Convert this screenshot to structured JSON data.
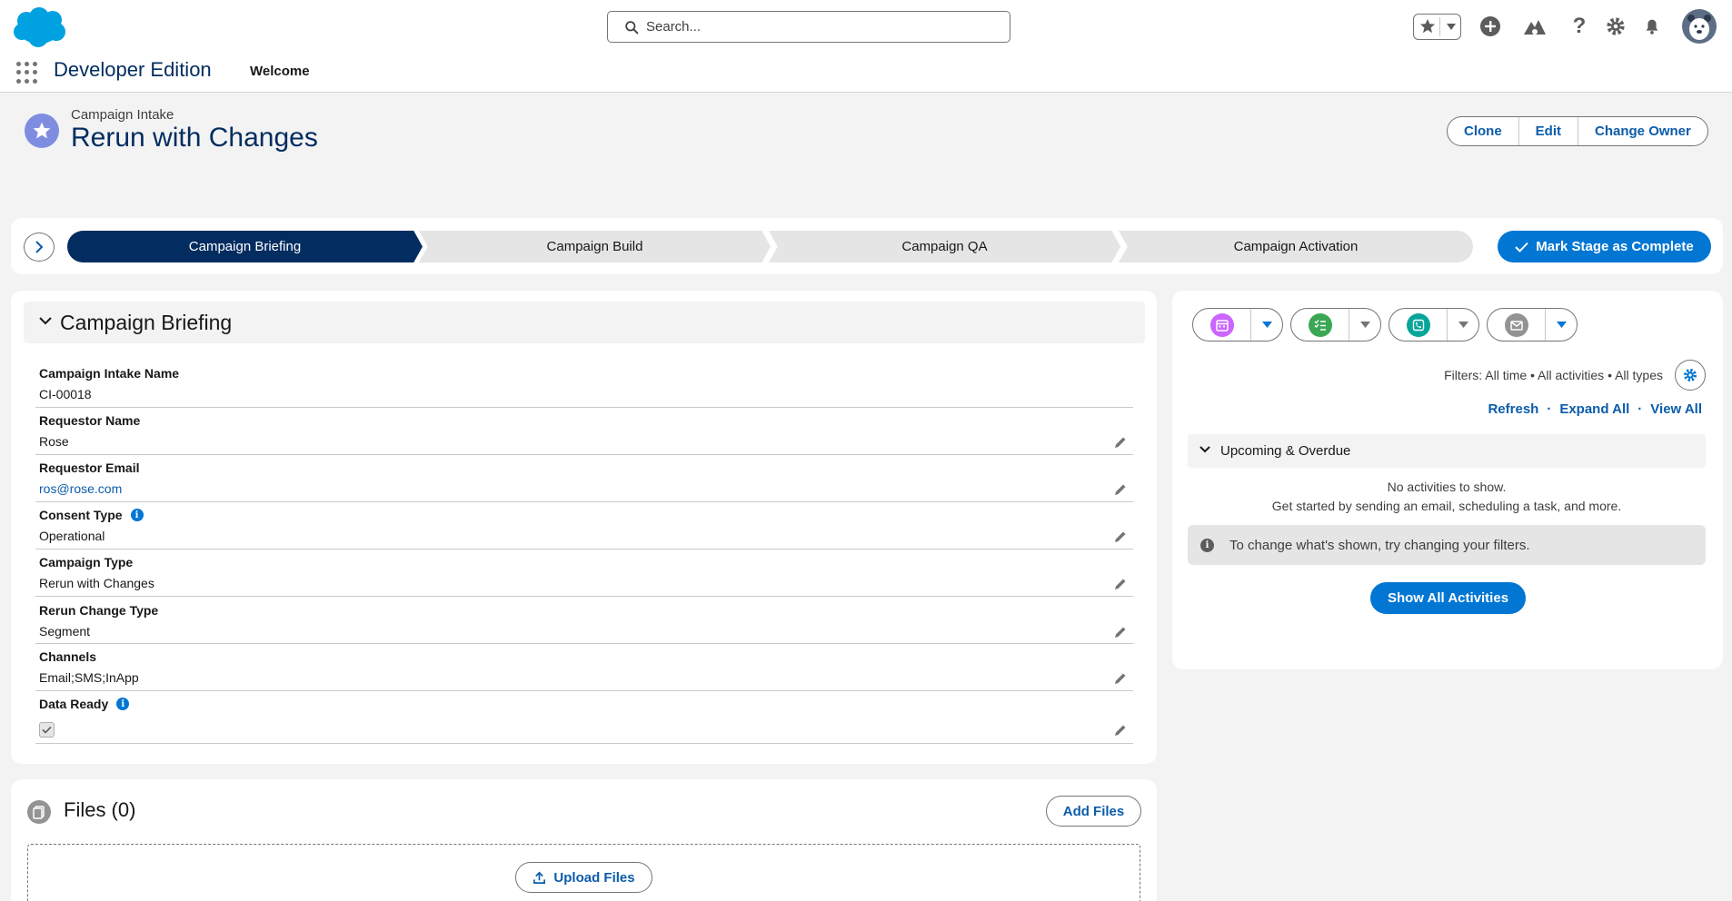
{
  "global": {
    "search_placeholder": "Search...",
    "app_name": "Developer Edition",
    "nav_tab": "Welcome"
  },
  "record": {
    "object_type": "Campaign Intake",
    "title": "Rerun with Changes",
    "actions": [
      "Clone",
      "Edit",
      "Change Owner"
    ]
  },
  "path": {
    "stages": [
      "Campaign Briefing",
      "Campaign Build",
      "Campaign QA",
      "Campaign Activation"
    ],
    "active_stage_index": 0,
    "mark_complete_label": "Mark Stage as Complete"
  },
  "details": {
    "section_title": "Campaign Briefing",
    "fields": [
      {
        "label": "Campaign Intake Name",
        "value": "CI-00018"
      },
      {
        "label": "Requestor Name",
        "value": "Rose"
      },
      {
        "label": "Requestor Email",
        "value": "ros@rose.com"
      },
      {
        "label": "Consent Type",
        "value": "Operational"
      },
      {
        "label": "Campaign Type",
        "value": "Rerun with Changes"
      },
      {
        "label": "Rerun Change Type",
        "value": "Segment"
      },
      {
        "label": "Channels",
        "value": "Email;SMS;InApp"
      },
      {
        "label": "Data Ready",
        "value": "checked"
      }
    ]
  },
  "files": {
    "title": "Files (0)",
    "add_label": "Add Files",
    "upload_label": "Upload Files"
  },
  "activity": {
    "filters_text": "Filters: All time • All activities • All types",
    "links": [
      "Refresh",
      "Expand All",
      "View All"
    ],
    "upcoming_label": "Upcoming & Overdue",
    "no_activities": "No activities to show.",
    "get_started": "Get started by sending an email, scheduling a task, and more.",
    "tip": "To change what's shown, try changing your filters.",
    "show_all_label": "Show All Activities"
  },
  "colors": {
    "brand_blue": "#0176d3",
    "navy": "#032d60",
    "link_blue": "#0b5cab"
  }
}
